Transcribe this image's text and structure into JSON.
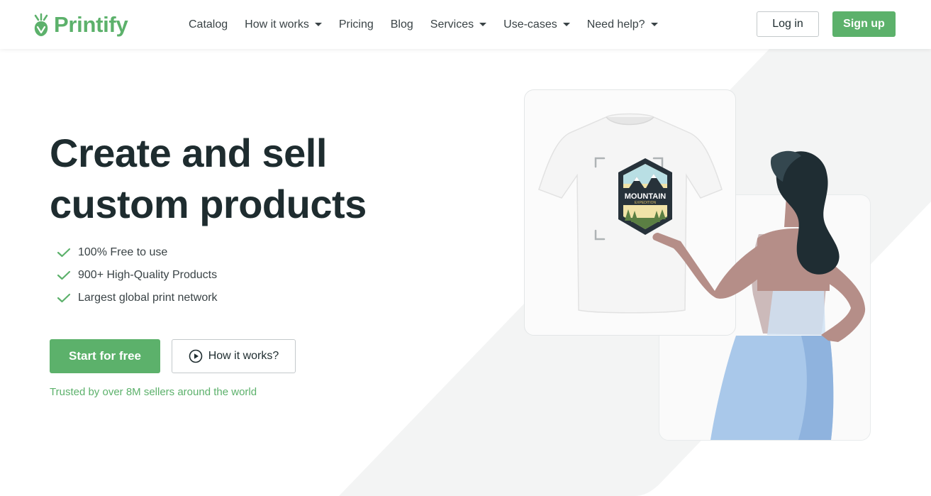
{
  "brand": {
    "name": "Printify",
    "color": "#5cb16b"
  },
  "nav": {
    "items": [
      {
        "label": "Catalog",
        "has_dropdown": false
      },
      {
        "label": "How it works",
        "has_dropdown": true
      },
      {
        "label": "Pricing",
        "has_dropdown": false
      },
      {
        "label": "Blog",
        "has_dropdown": false
      },
      {
        "label": "Services",
        "has_dropdown": true
      },
      {
        "label": "Use-cases",
        "has_dropdown": true
      },
      {
        "label": "Need help?",
        "has_dropdown": true
      }
    ],
    "login_label": "Log in",
    "signup_label": "Sign up"
  },
  "hero": {
    "title_line1": "Create and sell",
    "title_line2": "custom products",
    "features": [
      "100% Free to use",
      "900+ High-Quality Products",
      "Largest global print network"
    ],
    "primary_cta": "Start for free",
    "secondary_cta": "How it works?",
    "trusted_text": "Trusted by over 8M sellers around the world"
  },
  "illustration": {
    "design_title": "MOUNTAIN",
    "design_subtitle": "EXPEDITION"
  },
  "icons": {
    "check": "check-icon",
    "play": "play-circle-icon",
    "caret": "caret-down-icon"
  },
  "colors": {
    "accent": "#5cb16b",
    "text_dark": "#1e2c2f",
    "text_muted": "#3a4346",
    "skirt": "#a9c8ea",
    "skin": "#b58e88",
    "hair": "#1f2d33"
  }
}
